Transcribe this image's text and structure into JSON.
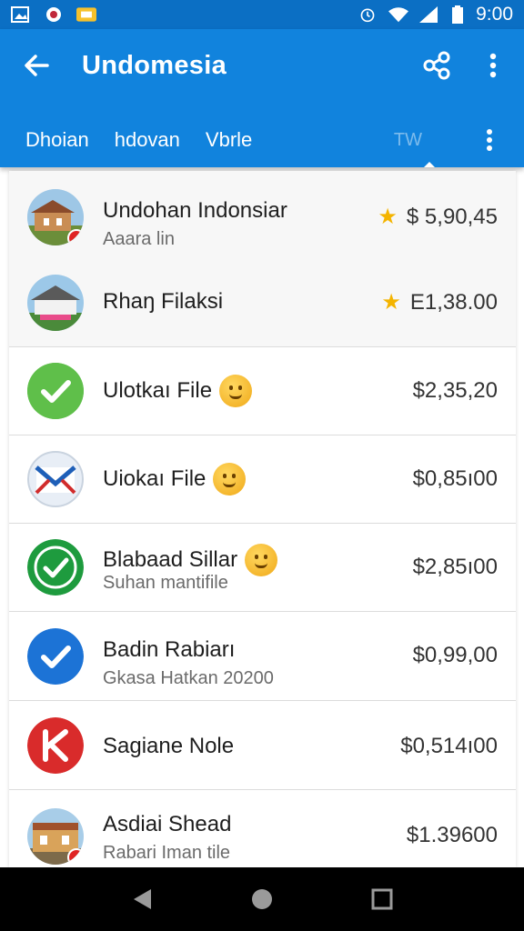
{
  "status_bar": {
    "time": "9:00",
    "icons": [
      "gallery-icon",
      "app-icon",
      "mail-icon",
      "alarm-icon",
      "wifi-icon",
      "signal-icon",
      "battery-icon"
    ]
  },
  "app_bar": {
    "title": "Undomesia",
    "back_icon": "arrow-left-icon",
    "actions": [
      "share-icon",
      "more-vert-icon"
    ]
  },
  "tabs": [
    {
      "label": "Dhoian"
    },
    {
      "label": "hdovan"
    },
    {
      "label": "Vbrle"
    },
    {
      "label": "TW"
    }
  ],
  "list": [
    {
      "title": "Undohan Indonsiar",
      "subtitle": "Aaara lin",
      "amount": "$ 5,90,45",
      "starred": true,
      "avatar": "house-photo"
    },
    {
      "title": "Rhaŋ Filaksi",
      "subtitle": "",
      "amount": "E1,38.00",
      "starred": true,
      "avatar": "house-photo"
    },
    {
      "title": "Ulotkaı File",
      "subtitle": "",
      "amount": "$2,35,20",
      "starred": false,
      "emoji": true,
      "avatar": "green-check"
    },
    {
      "title": "Uiokaı File",
      "subtitle": "",
      "amount": "$0,85ı00",
      "starred": false,
      "emoji": true,
      "avatar": "mail-envelope"
    },
    {
      "title": "Blabaad Sillar",
      "subtitle": "Suhan mantifile",
      "amount": "$2,85ı00",
      "starred": false,
      "emoji": true,
      "avatar": "green-check-solid"
    },
    {
      "title": "Badin Rabiarı",
      "subtitle": "Gkasa Hatkan 20200",
      "amount": "$0,99,00",
      "starred": false,
      "avatar": "blue-check"
    },
    {
      "title": "Sagiane Nole",
      "subtitle": "",
      "amount": "$0,514ı00",
      "starred": false,
      "avatar": "red-logo"
    },
    {
      "title": "Asdiai Shead",
      "subtitle": "Rabari Iman tile",
      "amount": "$1.39600",
      "starred": false,
      "avatar": "building-photo"
    }
  ],
  "colors": {
    "status_bar": "#0b6fc4",
    "app_bar": "#1183dd",
    "star": "#f4b400"
  }
}
